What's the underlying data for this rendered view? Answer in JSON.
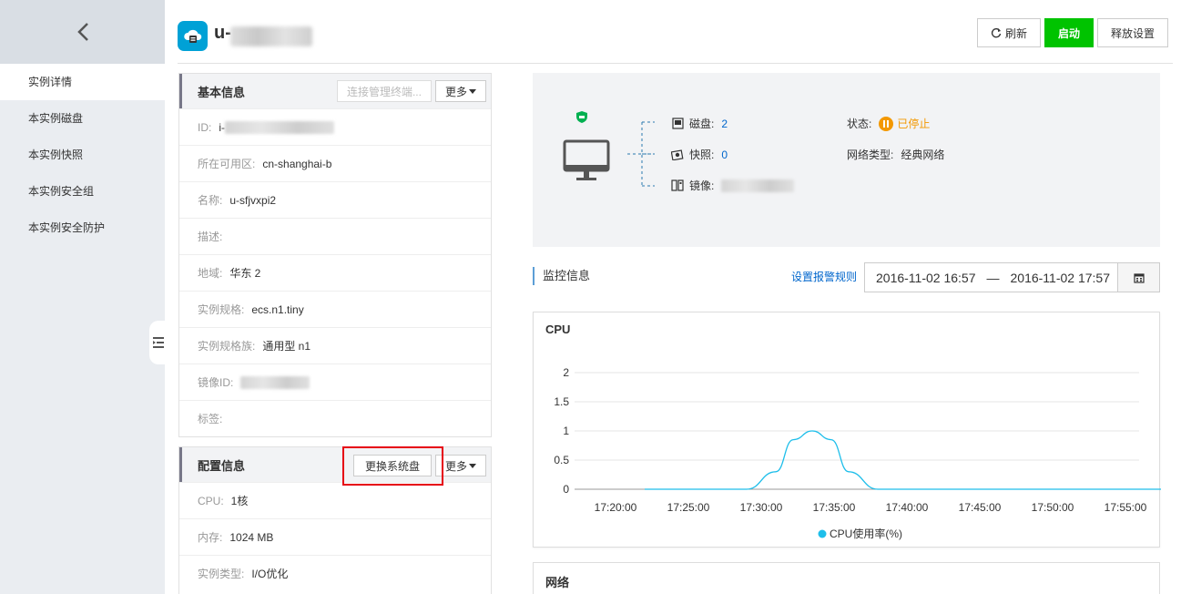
{
  "sidebar": {
    "items": [
      {
        "label": "实例详情",
        "active": true
      },
      {
        "label": "本实例磁盘"
      },
      {
        "label": "本实例快照"
      },
      {
        "label": "本实例安全组"
      },
      {
        "label": "本实例安全防护"
      }
    ]
  },
  "header": {
    "title_prefix": "u-",
    "refresh_label": "刷新",
    "start_label": "启动",
    "release_label": "释放设置"
  },
  "basic_info": {
    "title": "基本信息",
    "connect_label": "连接管理终端...",
    "more_label": "更多",
    "rows": [
      {
        "key": "ID:",
        "value": "i-"
      },
      {
        "key": "所在可用区:",
        "value": "cn-shanghai-b"
      },
      {
        "key": "名称:",
        "value": "u-sfjvxpi2"
      },
      {
        "key": "描述:",
        "value": ""
      },
      {
        "key": "地域:",
        "value": "华东 2"
      },
      {
        "key": "实例规格:",
        "value": "ecs.n1.tiny"
      },
      {
        "key": "实例规格族:",
        "value": "通用型 n1"
      },
      {
        "key": "镜像ID:",
        "value": ""
      },
      {
        "key": "标签:",
        "value": ""
      }
    ]
  },
  "config_info": {
    "title": "配置信息",
    "change_disk_label": "更换系统盘",
    "more_label": "更多",
    "rows": [
      {
        "key": "CPU:",
        "value": "1核"
      },
      {
        "key": "内存:",
        "value": "1024 MB"
      },
      {
        "key": "实例类型:",
        "value": "I/O优化"
      }
    ]
  },
  "overview": {
    "disk_label": "磁盘:",
    "disk_value": "2",
    "snapshot_label": "快照:",
    "snapshot_value": "0",
    "image_label": "镜像:",
    "status_label": "状态:",
    "status_value": "已停止",
    "network_label": "网络类型:",
    "network_value": "经典网络",
    "colors": {
      "status": "#f39800",
      "link": "#0066cc"
    }
  },
  "monitor": {
    "title": "监控信息",
    "alarm_link": "设置报警规则",
    "date_start": "2016-11-02 16:57",
    "date_separator": "—",
    "date_end": "2016-11-02 17:57",
    "network_title": "网络"
  },
  "chart_data": {
    "type": "line",
    "title": "CPU",
    "x": [
      "17:20:00",
      "17:25:00",
      "17:30:00",
      "17:35:00",
      "17:40:00",
      "17:45:00",
      "17:50:00",
      "17:55:00"
    ],
    "yticks": [
      "0",
      "0.5",
      "1",
      "1.5",
      "2"
    ],
    "ylim": [
      0,
      2
    ],
    "series": [
      {
        "name": "CPU使用率(%)",
        "color": "#1ebeea",
        "points": [
          [
            17.22,
            0
          ],
          [
            17.29,
            0
          ],
          [
            17.31,
            0.3
          ],
          [
            17.322,
            0.85
          ],
          [
            17.335,
            1
          ],
          [
            17.348,
            0.85
          ],
          [
            17.36,
            0.3
          ],
          [
            17.38,
            0
          ],
          [
            17.92,
            0
          ]
        ]
      }
    ],
    "legend": "bottom-center",
    "grid": true
  }
}
